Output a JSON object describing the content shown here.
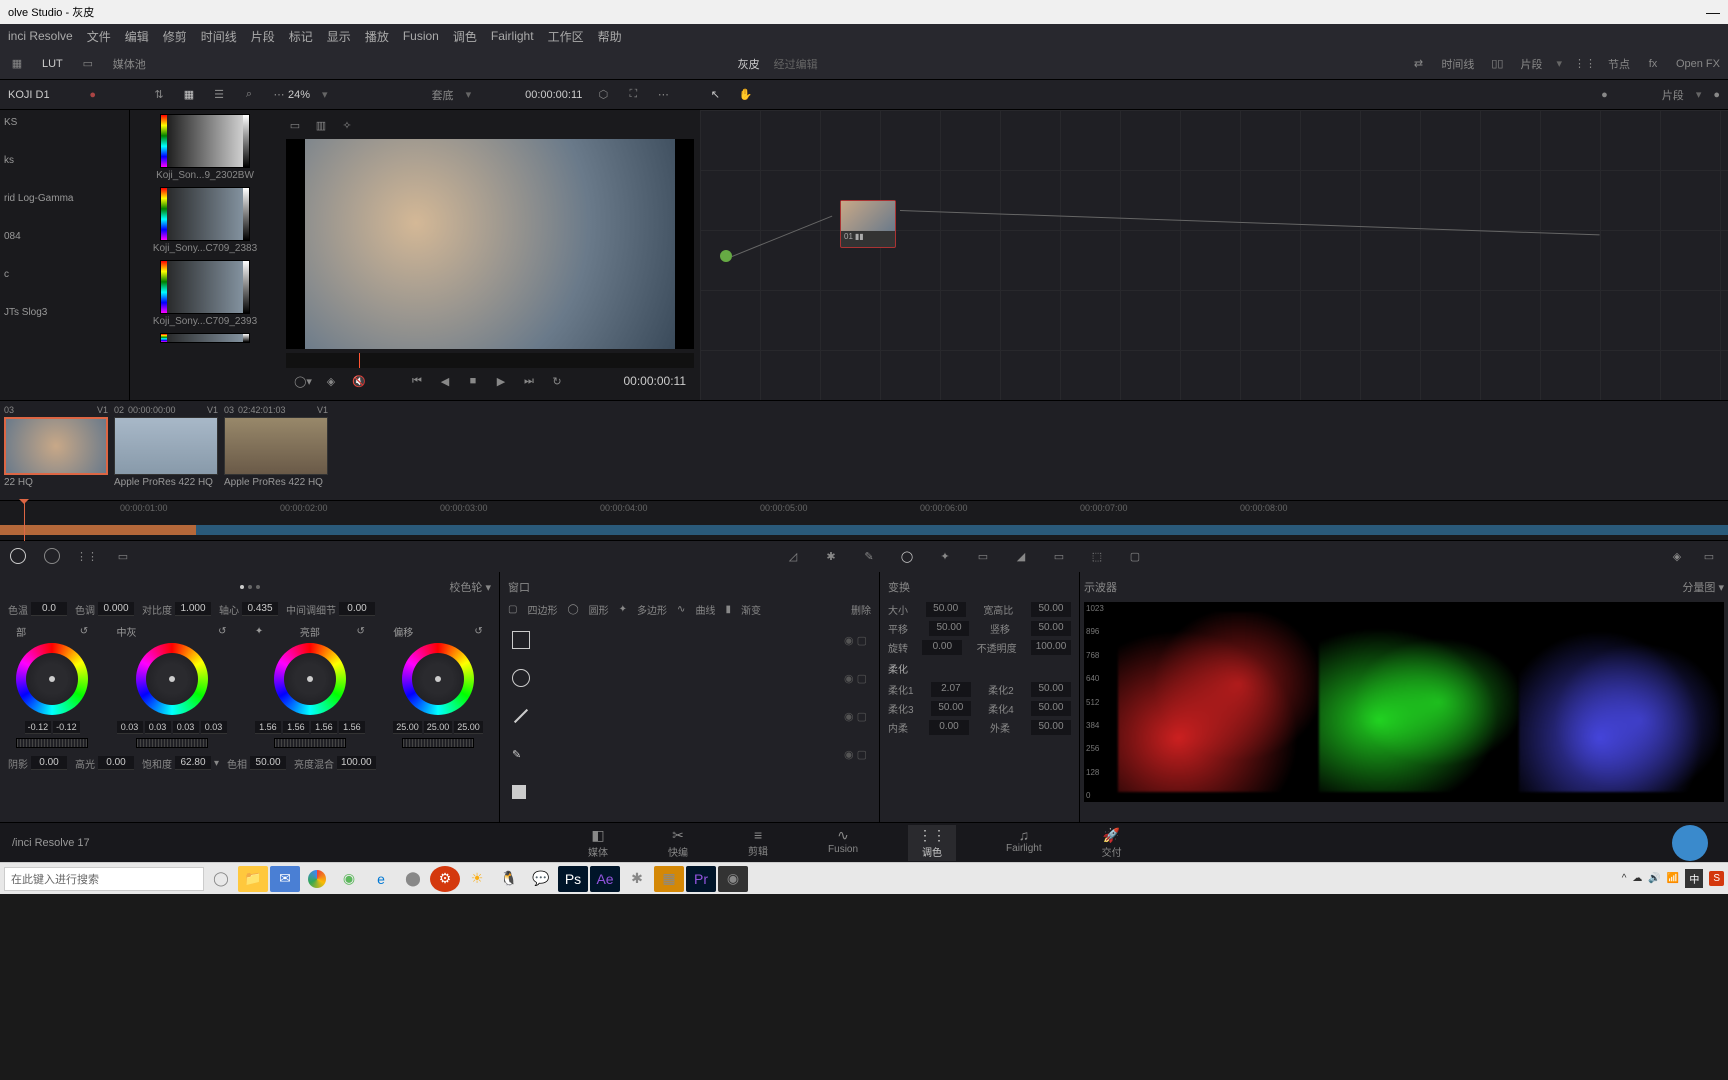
{
  "title": "olve Studio - 灰皮",
  "menu": [
    "inci Resolve",
    "文件",
    "编辑",
    "修剪",
    "时间线",
    "片段",
    "标记",
    "显示",
    "播放",
    "Fusion",
    "调色",
    "Fairlight",
    "工作区",
    "帮助"
  ],
  "secondbar": {
    "lut": "LUT",
    "mediapool": "媒体池",
    "center": "灰皮",
    "center_sub": "经过编辑",
    "timeline": "时间线",
    "clips": "片段",
    "nodes": "节点",
    "openfx": "Open FX"
  },
  "toolbar3": {
    "panel": "KOJI D1",
    "zoom": "24%",
    "fit": "套底",
    "tc": "00:00:00:11",
    "clips_dd": "片段"
  },
  "lut_tree": [
    "KS",
    "ks",
    "rid Log-Gamma",
    "084",
    "c",
    "JTs Slog3"
  ],
  "luts": [
    {
      "name": "Koji_Son...9_2302BW"
    },
    {
      "name": "Koji_Sony...C709_2383"
    },
    {
      "name": "Koji_Sony...C709_2393"
    }
  ],
  "viewer_tc": "00:00:00:11",
  "node_label": "01",
  "clips": [
    {
      "hdr": "03",
      "tc": "",
      "trk": "V1",
      "name": "22 HQ",
      "active": true
    },
    {
      "hdr": "02",
      "tc": "00:00:00:00",
      "trk": "V1",
      "name": "Apple ProRes 422 HQ"
    },
    {
      "hdr": "03",
      "tc": "02:42:01:03",
      "trk": "V1",
      "name": "Apple ProRes 422 HQ"
    }
  ],
  "ruler": [
    "00:00:01:00",
    "00:00:02:00",
    "00:00:03:00",
    "00:00:04:00",
    "00:00:05:00",
    "00:00:06:00",
    "00:00:07:00",
    "00:00:08:00"
  ],
  "wheels_tab": "校色轮",
  "params_top": [
    {
      "label": "色温",
      "val": "0.0"
    },
    {
      "label": "色调",
      "val": "0.000"
    },
    {
      "label": "对比度",
      "val": "1.000"
    },
    {
      "label": "轴心",
      "val": "0.435"
    },
    {
      "label": "中间调细节",
      "val": "0.00"
    }
  ],
  "wheels": [
    {
      "label": "部",
      "nums": [
        "-0.12",
        "-0.12"
      ]
    },
    {
      "label": "中灰",
      "nums": [
        "0.03",
        "0.03",
        "0.03",
        "0.03"
      ]
    },
    {
      "label": "亮部",
      "nums": [
        "1.56",
        "1.56",
        "1.56",
        "1.56"
      ]
    },
    {
      "label": "偏移",
      "nums": [
        "25.00",
        "25.00",
        "25.00"
      ]
    }
  ],
  "params_bot": [
    {
      "label": "阴影",
      "val": "0.00"
    },
    {
      "label": "高光",
      "val": "0.00"
    },
    {
      "label": "饱和度",
      "val": "62.80"
    },
    {
      "label": "色相",
      "val": "50.00"
    },
    {
      "label": "亮度混合",
      "val": "100.00"
    }
  ],
  "qualifier": {
    "title": "窗口",
    "tabs": [
      "四边形",
      "圆形",
      "多边形",
      "曲线",
      "渐变"
    ],
    "delete": "删除"
  },
  "transform": {
    "title": "变换",
    "rows": [
      {
        "l": "大小",
        "lv": "50.00",
        "r": "宽高比",
        "rv": "50.00"
      },
      {
        "l": "平移",
        "lv": "50.00",
        "r": "竖移",
        "rv": "50.00"
      },
      {
        "l": "旋转",
        "lv": "0.00",
        "r": "不透明度",
        "rv": "100.00"
      }
    ],
    "soft": "柔化",
    "softrows": [
      {
        "l": "柔化1",
        "lv": "2.07",
        "r": "柔化2",
        "rv": "50.00"
      },
      {
        "l": "柔化3",
        "lv": "50.00",
        "r": "柔化4",
        "rv": "50.00"
      },
      {
        "l": "内柔",
        "lv": "0.00",
        "r": "外柔",
        "rv": "50.00"
      }
    ]
  },
  "scopes": {
    "title": "示波器",
    "mode": "分量图",
    "scale": [
      "1023",
      "896",
      "768",
      "640",
      "512",
      "384",
      "256",
      "128",
      "0"
    ]
  },
  "nav": {
    "version": "/inci Resolve 17",
    "items": [
      {
        "label": "媒体",
        "icon": "◧"
      },
      {
        "label": "快编",
        "icon": "✂"
      },
      {
        "label": "剪辑",
        "icon": "≡"
      },
      {
        "label": "Fusion",
        "icon": "∿"
      },
      {
        "label": "调色",
        "icon": "⋮⋮",
        "active": true
      },
      {
        "label": "Fairlight",
        "icon": "♫"
      },
      {
        "label": "交付",
        "icon": "🚀"
      }
    ]
  },
  "taskbar": {
    "search": "在此键入进行搜索",
    "tray": "中"
  }
}
